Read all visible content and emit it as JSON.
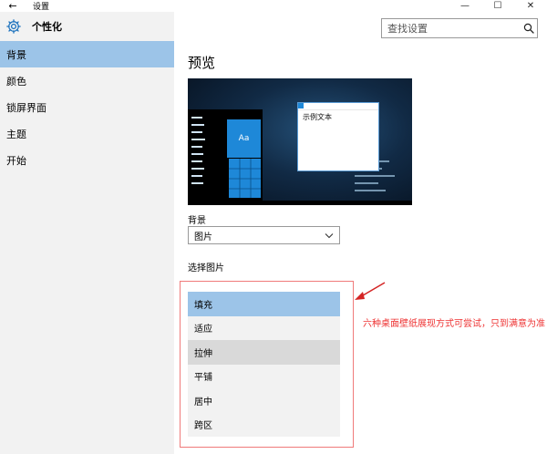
{
  "window": {
    "title": "设置",
    "minimize": "—",
    "maximize": "☐",
    "close": "✕",
    "back": "←"
  },
  "sidebar": {
    "title": "个性化",
    "items": [
      {
        "label": "背景",
        "active": true
      },
      {
        "label": "颜色"
      },
      {
        "label": "锁屏界面"
      },
      {
        "label": "主题"
      },
      {
        "label": "开始"
      }
    ]
  },
  "search": {
    "placeholder": "查找设置"
  },
  "main": {
    "title": "预览",
    "preview": {
      "tile_label": "Aa",
      "window_text": "示例文本"
    },
    "background_label": "背景",
    "background_value": "图片",
    "choose_label": "选择图片",
    "fit_options": [
      "填充",
      "适应",
      "拉伸",
      "平铺",
      "居中",
      "跨区"
    ],
    "selected_fit": "填充",
    "hover_fit": "拉伸"
  },
  "annotation": {
    "text": "六种桌面壁纸展现方式可尝试，只到满意为准"
  },
  "colors": {
    "accent": "#9cc4e8",
    "tile_blue": "#1e88d8",
    "annotation_red": "#e33333"
  }
}
